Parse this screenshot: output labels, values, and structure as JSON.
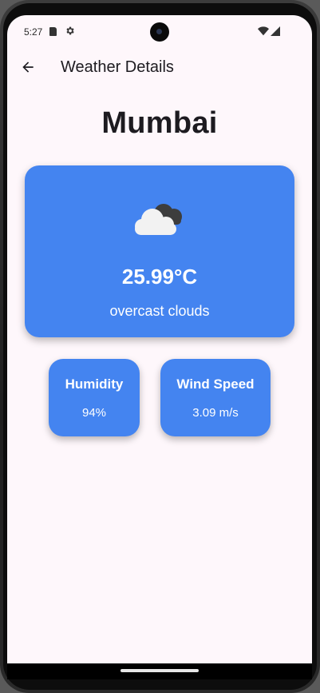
{
  "status_bar": {
    "time": "5:27",
    "icons": [
      "sd-card-icon",
      "gear-icon",
      "wifi-icon",
      "signal-icon"
    ]
  },
  "app_bar": {
    "back_icon": "arrow-left-icon",
    "title": "Weather Details"
  },
  "weather": {
    "city": "Mumbai",
    "condition_icon": "cloud-icon",
    "temperature": "25.99°C",
    "description": "overcast clouds",
    "humidity": {
      "label": "Humidity",
      "value": "94%"
    },
    "wind": {
      "label": "Wind Speed",
      "value": "3.09 m/s"
    }
  },
  "colors": {
    "background": "#fef7fb",
    "card": "#4484f0",
    "text_dark": "#1d1b20",
    "text_on_card": "#ffffff"
  }
}
